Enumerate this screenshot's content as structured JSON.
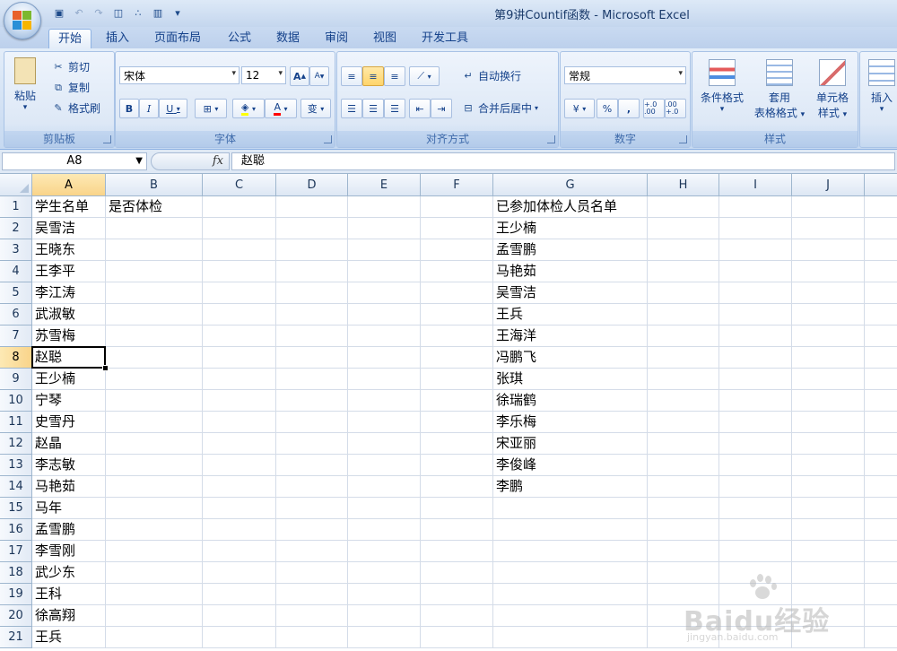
{
  "window": {
    "title": "第9讲Countif函数 - Microsoft Excel"
  },
  "tabs": [
    "开始",
    "插入",
    "页面布局",
    "公式",
    "数据",
    "审阅",
    "视图",
    "开发工具"
  ],
  "ribbon": {
    "clipboard": {
      "label": "剪贴板",
      "paste": "粘贴",
      "cut": "剪切",
      "copy": "复制",
      "format_painter": "格式刷"
    },
    "font": {
      "label": "字体",
      "name": "宋体",
      "size": "12",
      "bold": "B",
      "italic": "I",
      "underline": "U",
      "grow": "A",
      "shrink": "A",
      "font_color": "A",
      "phonetic": "变"
    },
    "alignment": {
      "label": "对齐方式",
      "wrap": "自动换行",
      "merge": "合并后居中"
    },
    "number": {
      "label": "数字",
      "format": "常规",
      "percent": "%",
      "comma": ",",
      "inc_decimal": "+.0 .00",
      "dec_decimal": ".00 +.0"
    },
    "styles": {
      "label": "样式",
      "conditional": "条件格式",
      "table_l1": "套用",
      "table_l2": "表格格式",
      "cell_l1": "单元格",
      "cell_l2": "样式"
    },
    "cells": {
      "insert": "插入"
    }
  },
  "formula_bar": {
    "name_box": "A8",
    "fx": "fx",
    "formula": "赵聪"
  },
  "sheet": {
    "columns": [
      "A",
      "B",
      "C",
      "D",
      "E",
      "F",
      "G",
      "H",
      "I",
      "J"
    ],
    "selected_column": "A",
    "selected_row": 8,
    "active_cell": "A8",
    "rows": [
      {
        "n": "1",
        "A": "学生名单",
        "B": "是否体检",
        "G": "已参加体检人员名单"
      },
      {
        "n": "2",
        "A": "吴雪洁",
        "G": "王少楠"
      },
      {
        "n": "3",
        "A": "王晓东",
        "G": "孟雪鹏"
      },
      {
        "n": "4",
        "A": "王李平",
        "G": "马艳茹"
      },
      {
        "n": "5",
        "A": "李江涛",
        "G": "吴雪洁"
      },
      {
        "n": "6",
        "A": "武淑敏",
        "G": "王兵"
      },
      {
        "n": "7",
        "A": "苏雪梅",
        "G": "王海洋"
      },
      {
        "n": "8",
        "A": "赵聪",
        "G": "冯鹏飞"
      },
      {
        "n": "9",
        "A": "王少楠",
        "G": "张琪"
      },
      {
        "n": "10",
        "A": "宁琴",
        "G": "徐瑞鹤"
      },
      {
        "n": "11",
        "A": "史雪丹",
        "G": "李乐梅"
      },
      {
        "n": "12",
        "A": "赵晶",
        "G": "宋亚丽"
      },
      {
        "n": "13",
        "A": "李志敏",
        "G": "李俊峰"
      },
      {
        "n": "14",
        "A": "马艳茹",
        "G": "李鹏"
      },
      {
        "n": "15",
        "A": "马年"
      },
      {
        "n": "16",
        "A": "孟雪鹏"
      },
      {
        "n": "17",
        "A": "李雪刚"
      },
      {
        "n": "18",
        "A": "武少东"
      },
      {
        "n": "19",
        "A": "王科"
      },
      {
        "n": "20",
        "A": "徐高翔"
      },
      {
        "n": "21",
        "A": "王兵"
      }
    ]
  },
  "watermark": {
    "text": "Baidu经验",
    "url": "jingyan.baidu.com"
  }
}
